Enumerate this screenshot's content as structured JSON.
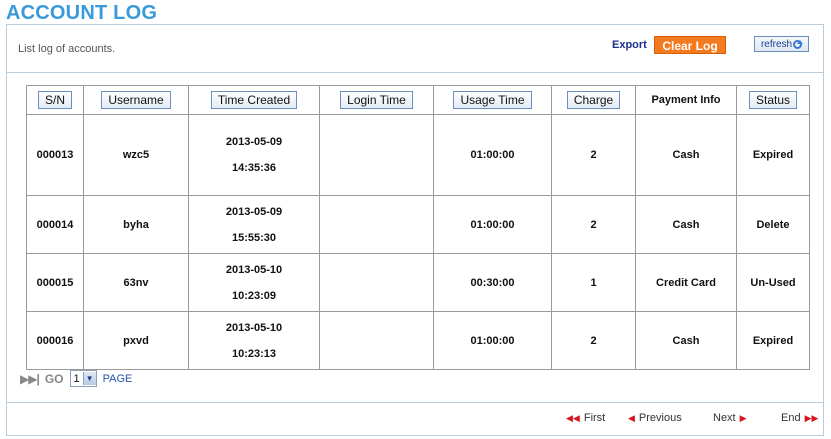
{
  "page": {
    "title": "ACCOUNT LOG"
  },
  "header": {
    "description": "List log of accounts.",
    "export_label": "Export",
    "clear_label": "Clear Log",
    "refresh_label": "refresh"
  },
  "table": {
    "columns": [
      "S/N",
      "Username",
      "Time Created",
      "Login Time",
      "Usage Time",
      "Charge",
      "Payment Info",
      "Status"
    ],
    "rows": [
      {
        "sn": "000013",
        "username": "wzc5",
        "created_date": "2013-05-09",
        "created_time": "14:35:36",
        "login_time": "",
        "usage_time": "01:00:00",
        "charge": "2",
        "payment": "Cash",
        "status": "Expired"
      },
      {
        "sn": "000014",
        "username": "byha",
        "created_date": "2013-05-09",
        "created_time": "15:55:30",
        "login_time": "",
        "usage_time": "01:00:00",
        "charge": "2",
        "payment": "Cash",
        "status": "Delete"
      },
      {
        "sn": "000015",
        "username": "63nv",
        "created_date": "2013-05-10",
        "created_time": "10:23:09",
        "login_time": "",
        "usage_time": "00:30:00",
        "charge": "1",
        "payment": "Credit Card",
        "status": "Un-Used"
      },
      {
        "sn": "000016",
        "username": "pxvd",
        "created_date": "2013-05-10",
        "created_time": "10:23:13",
        "login_time": "",
        "usage_time": "01:00:00",
        "charge": "2",
        "payment": "Cash",
        "status": "Expired"
      }
    ]
  },
  "go": {
    "label": "GO",
    "page_value": "1",
    "page_word": "PAGE"
  },
  "pager": {
    "first": "First",
    "previous": "Previous",
    "next": "Next",
    "end": "End"
  },
  "colors": {
    "title": "#3a9ad9",
    "clear_button": "#f47a1f",
    "pager_icon": "#d6151f"
  }
}
